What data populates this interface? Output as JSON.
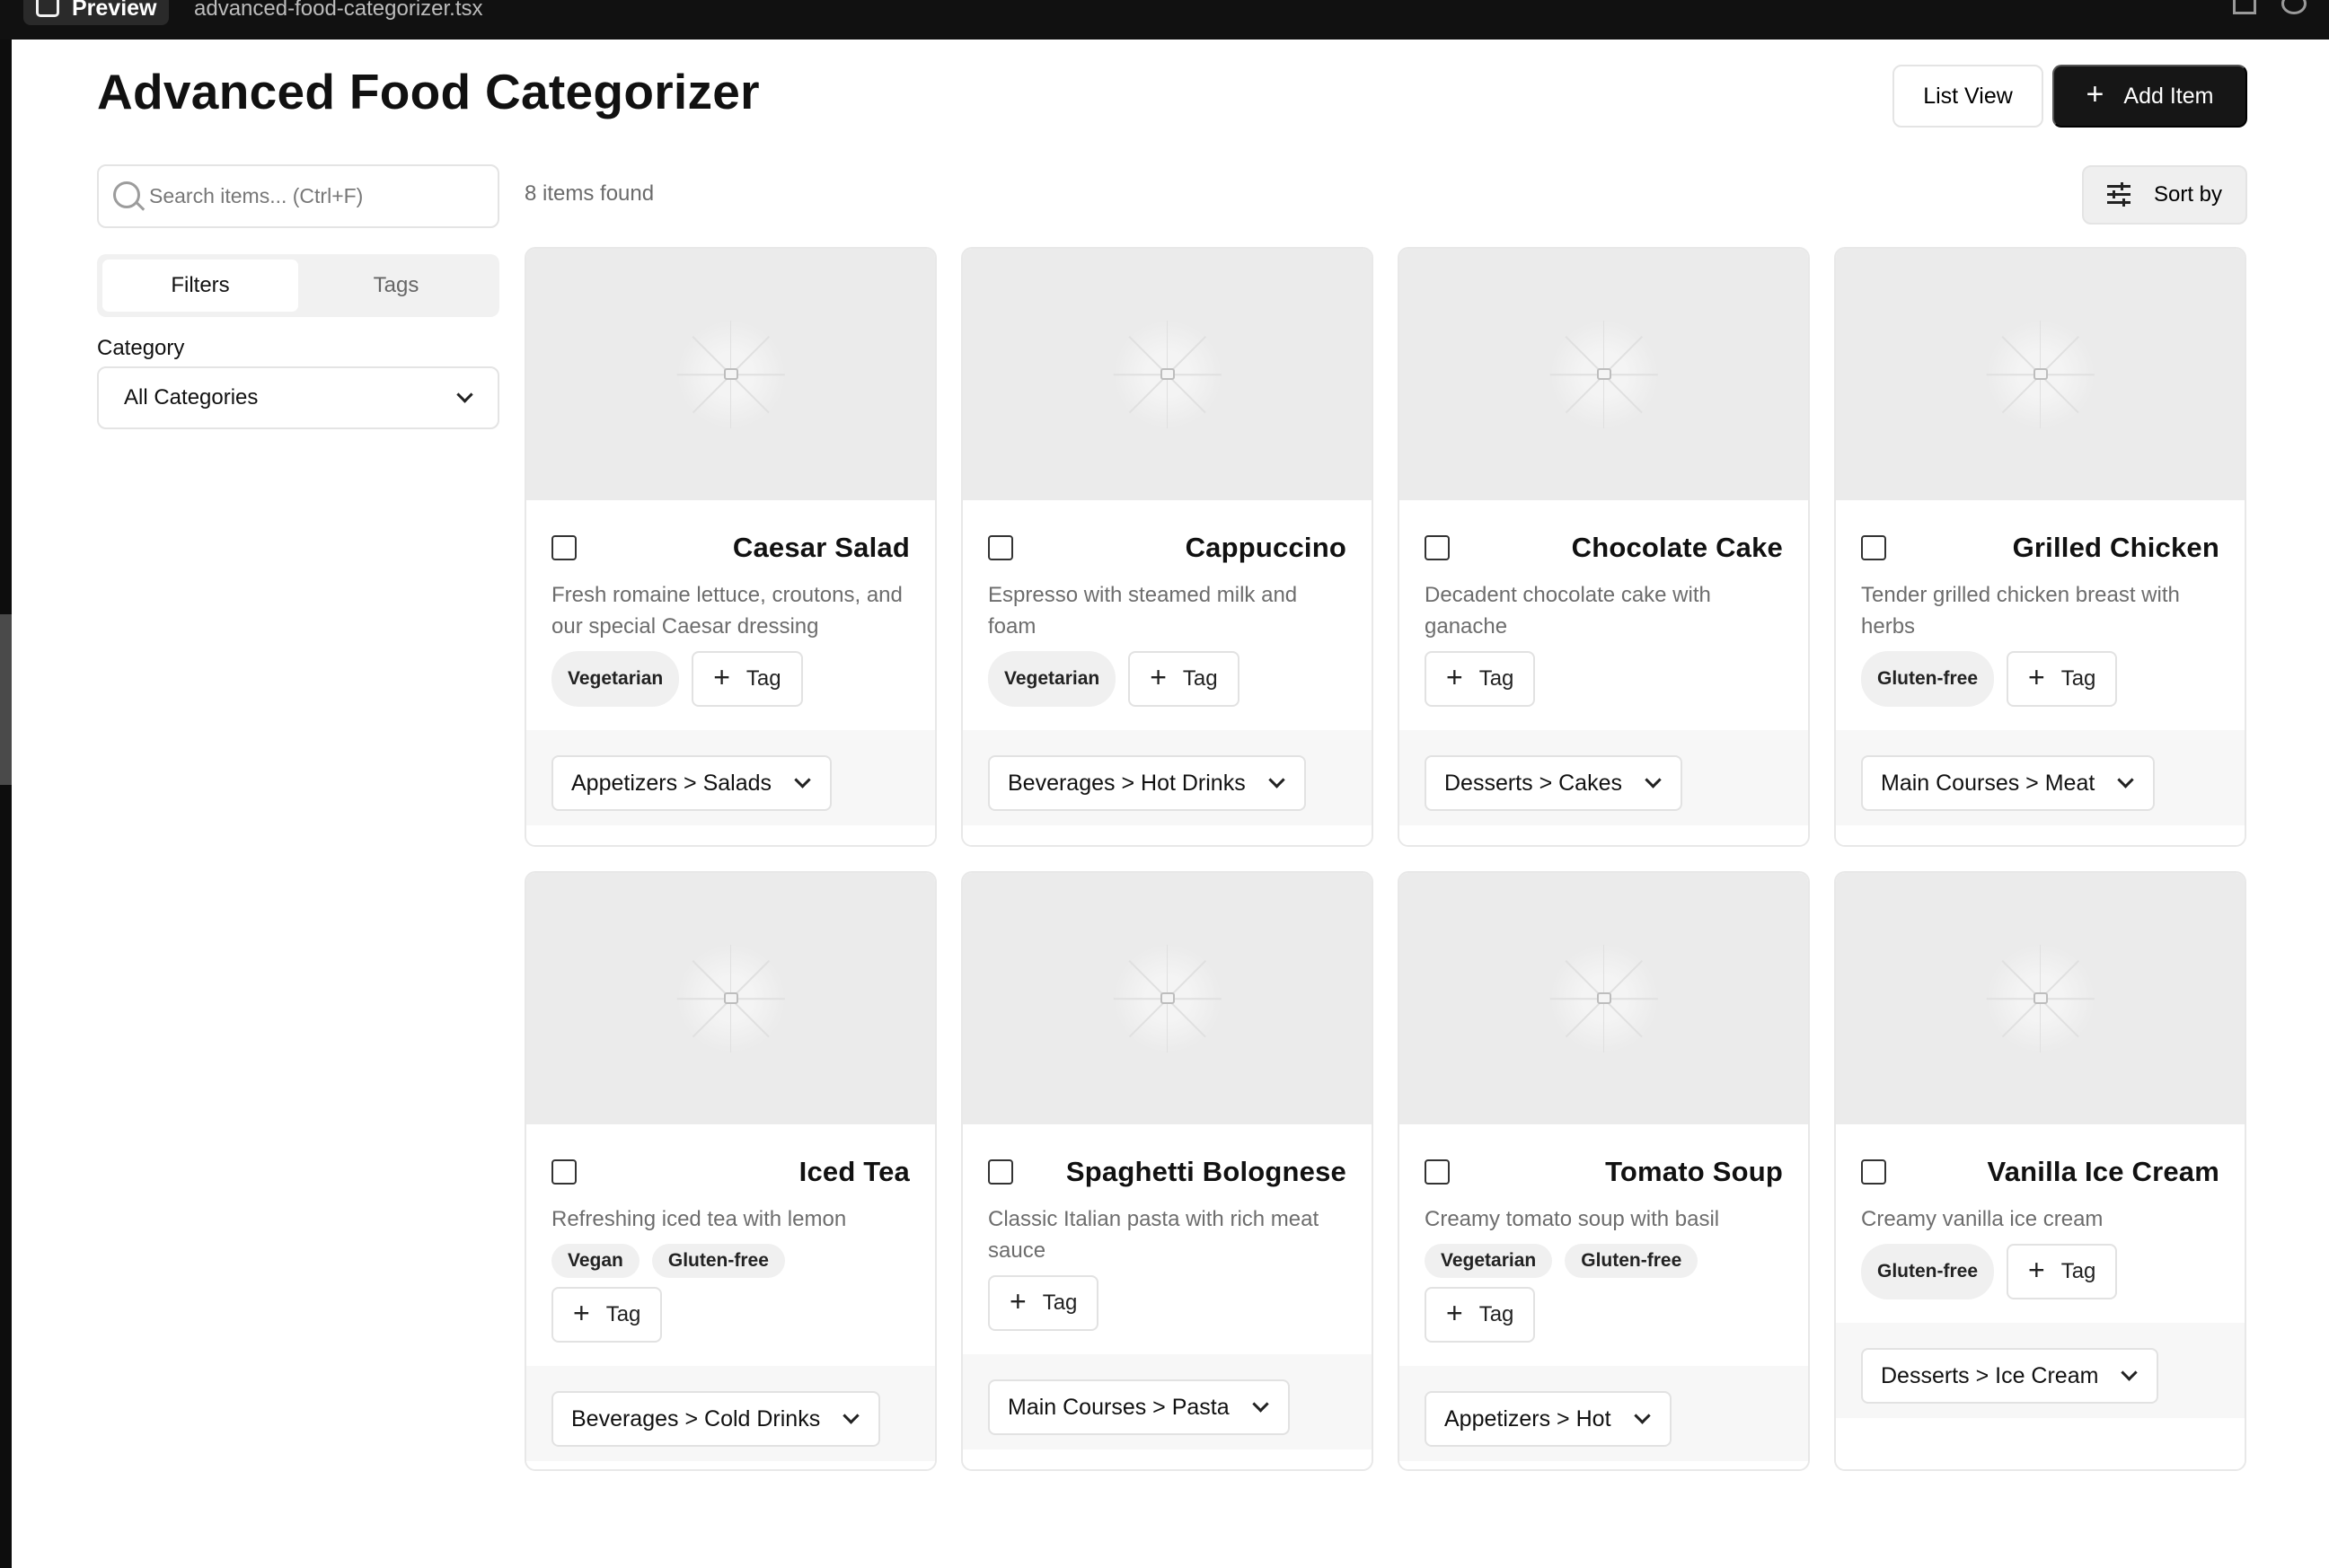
{
  "editor": {
    "tab_label": "Preview",
    "file_name": "advanced-food-categorizer.tsx"
  },
  "header": {
    "title": "Advanced Food Categorizer",
    "list_view_label": "List View",
    "add_item_label": "Add Item",
    "add_item_icon": "+"
  },
  "search": {
    "placeholder": "Search items... (Ctrl+F)",
    "value": ""
  },
  "results": {
    "count_text": "8 items found",
    "sort_label": "Sort by"
  },
  "sidebar": {
    "tabs": [
      {
        "label": "Filters",
        "active": true
      },
      {
        "label": "Tags",
        "active": false
      }
    ],
    "category_label": "Category",
    "category_value": "All Categories"
  },
  "tag_button_label": "Tag",
  "plus_glyph": "+",
  "items": [
    {
      "name": "Caesar Salad",
      "description": "Fresh romaine lettuce, croutons, and our special Caesar dressing",
      "tags": [
        "Vegetarian"
      ],
      "category": "Appetizers > Salads"
    },
    {
      "name": "Cappuccino",
      "description": "Espresso with steamed milk and foam",
      "tags": [
        "Vegetarian"
      ],
      "category": "Beverages > Hot Drinks"
    },
    {
      "name": "Chocolate Cake",
      "description": "Decadent chocolate cake with ganache",
      "tags": [],
      "category": "Desserts > Cakes"
    },
    {
      "name": "Grilled Chicken",
      "description": "Tender grilled chicken breast with herbs",
      "tags": [
        "Gluten-free"
      ],
      "category": "Main Courses > Meat"
    },
    {
      "name": "Iced Tea",
      "description": "Refreshing iced tea with lemon",
      "tags": [
        "Vegan",
        "Gluten-free"
      ],
      "category": "Beverages > Cold Drinks"
    },
    {
      "name": "Spaghetti Bolognese",
      "description": "Classic Italian pasta with rich meat sauce",
      "tags": [],
      "category": "Main Courses > Pasta"
    },
    {
      "name": "Tomato Soup",
      "description": "Creamy tomato soup with basil",
      "tags": [
        "Vegetarian",
        "Gluten-free"
      ],
      "category": "Appetizers > Hot"
    },
    {
      "name": "Vanilla Ice Cream",
      "description": "Creamy vanilla ice cream",
      "tags": [
        "Gluten-free"
      ],
      "category": "Desserts > Ice Cream"
    }
  ],
  "colors": {
    "primary_button": "#161616",
    "image_placeholder": "#ebebeb",
    "chip_background": "#f0f0f0",
    "card_footer": "#f7f7f7"
  }
}
